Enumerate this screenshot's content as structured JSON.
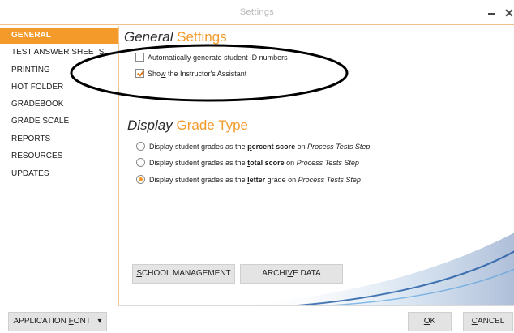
{
  "window": {
    "title": "Settings"
  },
  "sidebar": {
    "items": [
      {
        "label": "GENERAL",
        "active": true
      },
      {
        "label": "TEST ANSWER SHEETS"
      },
      {
        "label": "PRINTING"
      },
      {
        "label": "HOT FOLDER"
      },
      {
        "label": "GRADEBOOK"
      },
      {
        "label": "GRADE SCALE"
      },
      {
        "label": "REPORTS"
      },
      {
        "label": "RESOURCES"
      },
      {
        "label": "UPDATES"
      }
    ]
  },
  "general": {
    "title_a": "General",
    "title_b": "Settings",
    "auto_id": {
      "pre": "Automatically ",
      "key": "g",
      "post": "enerate student ID numbers",
      "checked": false
    },
    "assistant": {
      "pre": "Sho",
      "key": "w",
      "post": " the Instructor's Assistant",
      "checked": true
    }
  },
  "grade_type": {
    "title_a": "Display",
    "title_b": "Grade Type",
    "options": [
      {
        "pre": "Display student grades as the ",
        "key": "p",
        "bold": "ercent score",
        "mid": " on ",
        "ital": "Process Tests Step",
        "selected": false
      },
      {
        "pre": "Display student grades as the ",
        "key": "t",
        "bold": "otal score",
        "mid": " on ",
        "ital": "Process Tests Step",
        "selected": false
      },
      {
        "pre": "Display student grades as the ",
        "key": "l",
        "bold": "etter",
        "mid": " grade on ",
        "ital": "Process Tests Step",
        "selected": true
      }
    ]
  },
  "buttons": {
    "school_key": "S",
    "school_rest": "CHOOL MANAGEMENT",
    "archive_pre": "ARCHI",
    "archive_key": "V",
    "archive_post": "E DATA"
  },
  "footer": {
    "font_pre": "APPLICATION ",
    "font_key": "F",
    "font_post": "ONT",
    "font_caret": "▾",
    "ok_key": "O",
    "ok_post": "K",
    "cancel_key": "C",
    "cancel_post": "ANCEL"
  },
  "icons": {
    "minimize": "minimize-icon",
    "close": "close-icon",
    "annotation": "ellipse-annotation"
  },
  "colors": {
    "accent": "#f39a2b",
    "active_bg": "#f39a2b",
    "ellipse": "#000000"
  }
}
